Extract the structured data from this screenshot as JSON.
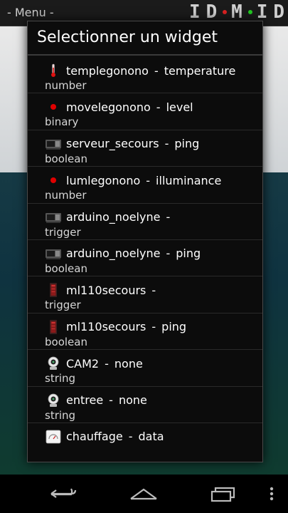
{
  "app": {
    "menu_label": "- Menu -",
    "logo_text": "DMD"
  },
  "dialog": {
    "title": "Selectionner un widget",
    "items": [
      {
        "name": "templegonono",
        "kind": "temperature",
        "type": "number",
        "icon": "thermometer-icon"
      },
      {
        "name": "movelegonono",
        "kind": "level",
        "type": "binary",
        "icon": "red-dot-icon"
      },
      {
        "name": "serveur_secours",
        "kind": "ping",
        "type": "boolean",
        "icon": "computer-icon"
      },
      {
        "name": "lumlegonono",
        "kind": "illuminance",
        "type": "number",
        "icon": "red-dot-icon"
      },
      {
        "name": "arduino_noelyne",
        "kind": "",
        "type": "trigger",
        "icon": "computer-icon"
      },
      {
        "name": "arduino_noelyne",
        "kind": "ping",
        "type": "boolean",
        "icon": "computer-icon"
      },
      {
        "name": "ml110secours",
        "kind": "",
        "type": "trigger",
        "icon": "server-tower-icon"
      },
      {
        "name": "ml110secours",
        "kind": "ping",
        "type": "boolean",
        "icon": "server-tower-icon"
      },
      {
        "name": "CAM2",
        "kind": "none",
        "type": "string",
        "icon": "webcam-icon"
      },
      {
        "name": "entree",
        "kind": "none",
        "type": "string",
        "icon": "webcam-icon"
      },
      {
        "name": "chauffage",
        "kind": "data",
        "type": "",
        "icon": "gauge-icon"
      }
    ]
  },
  "colors": {
    "red_dot": "#e00000",
    "dialog_bg": "#0c0c0c",
    "type_text": "#d6d6d6"
  }
}
